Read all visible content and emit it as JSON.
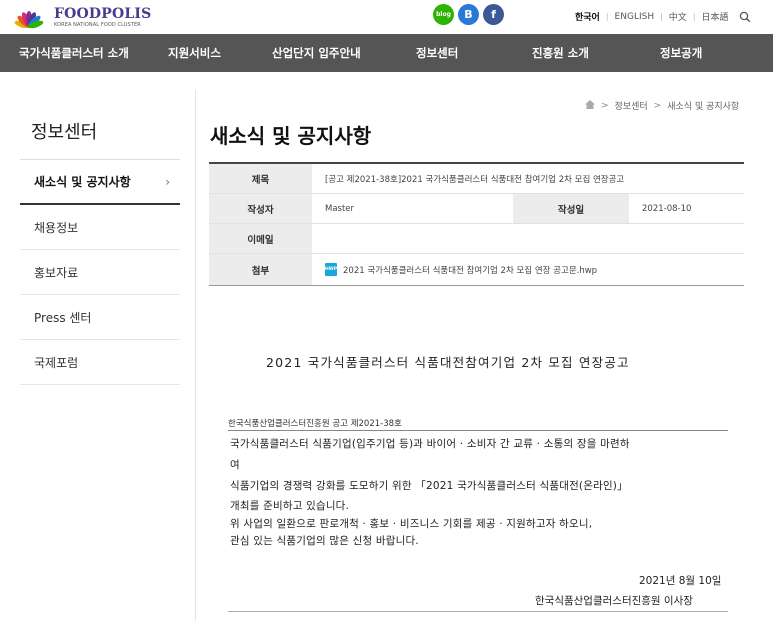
{
  "brand": {
    "name": "FOODPOLIS",
    "subtitle": "KOREA NATIONAL FOOD CLUSTER",
    "petal_colors": [
      "#f2a900",
      "#e8541e",
      "#d62a7a",
      "#8a2c8f",
      "#4a3b8f",
      "#2a78d8",
      "#2db400"
    ]
  },
  "social": {
    "blog": "blog",
    "band": "B",
    "facebook": "f"
  },
  "languages": [
    "한국어",
    "ENGLISH",
    "中文",
    "日本語"
  ],
  "nav": [
    "국가식품클러스터 소개",
    "지원서비스",
    "산업단지 입주안내",
    "정보센터",
    "진흥원 소개",
    "정보공개"
  ],
  "sidebar": {
    "title": "정보센터",
    "items": [
      "새소식 및 공지사항",
      "채용정보",
      "홍보자료",
      "Press 센터",
      "국제포럼"
    ]
  },
  "breadcrumb": [
    "정보센터",
    "새소식 및 공지사항"
  ],
  "page_title": "새소식 및 공지사항",
  "post": {
    "subject_label": "제목",
    "subject": "[공고 제2021-38호]2021 국가식품클러스터 식품대전 참여기업 2차 모집 연장공고",
    "author_label": "작성자",
    "author": "Master",
    "date_label": "작성일",
    "date": "2021-08-10",
    "email_label": "이메일",
    "email": "",
    "attach_label": "첨부",
    "attach_icon": "HWP",
    "attachment": "2021 국가식품클러스터 식품대전 참여기업 2차 모집 연장 공고문.hwp"
  },
  "document": {
    "title": "2021 국가식품클러스터 식품대전참여기업 2차 모집 연장공고",
    "ref": "한국식품산업클러스터진흥원 공고 제2021-38호",
    "lines": [
      "  국가식품클러스터 식품기업(입주기업 등)과 바이어 · 소비자 간 교류 ·  소통의 장을 마련하",
      "여",
      "식품기업의 경쟁력 강화를 도모하기 위한 「2021 국가식품클러스터 식품대전(온라인)」",
      "개최를 준비하고 있습니다.",
      "위 사업의 일환으로 판로개척 · 홍보 · 비즈니스 기회를 제공 · 지원하고자 하오니,",
      "관심 있는 식품기업의 많은 신청 바랍니다."
    ],
    "date": "2021년 8월 10일",
    "signature": "한국식품산업클러스터진흥원 이사장"
  }
}
